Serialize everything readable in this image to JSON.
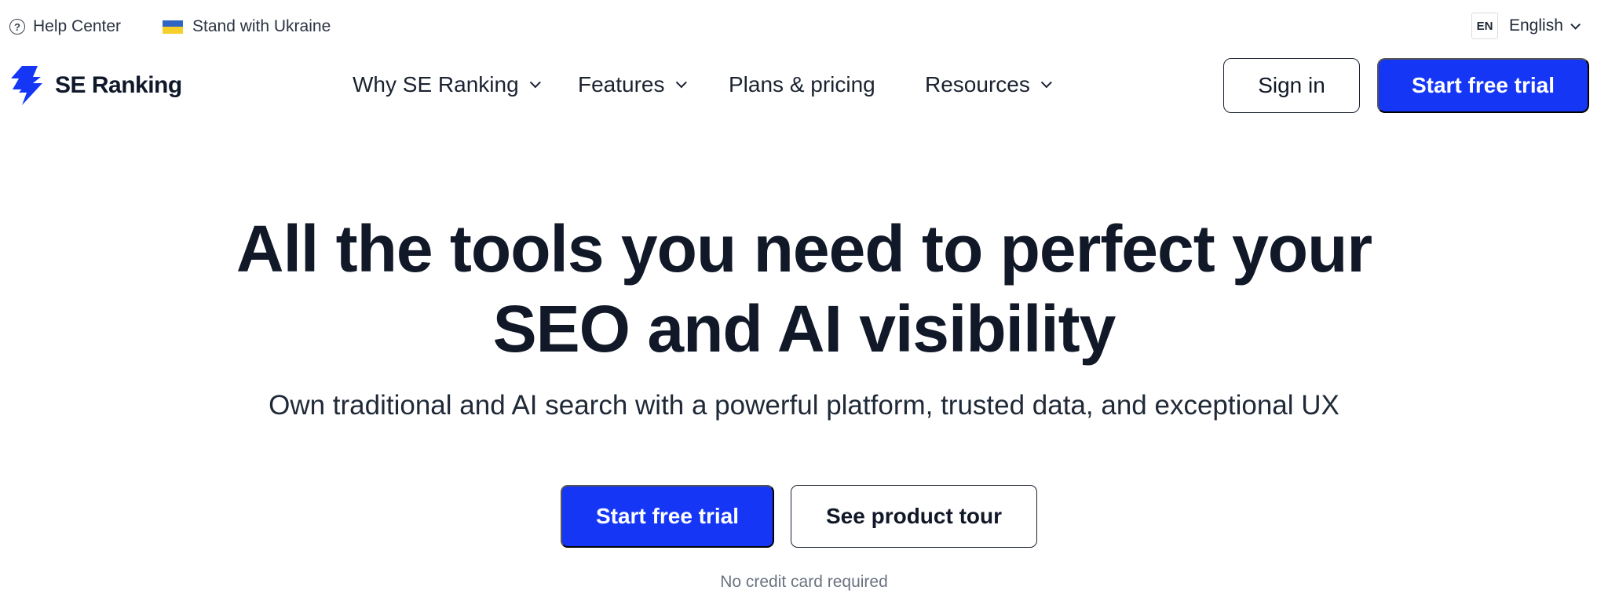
{
  "topbar": {
    "help_label": "Help Center",
    "help_icon": "question-circle-icon",
    "ukraine_label": "Stand with Ukraine",
    "ukraine_flag_colors": [
      "#2f63c4",
      "#f7cf2a"
    ],
    "lang_code": "EN",
    "lang_label": "English"
  },
  "nav": {
    "logo_text": "SE Ranking",
    "items": [
      {
        "label": "Why SE Ranking",
        "has_dropdown": true
      },
      {
        "label": "Features",
        "has_dropdown": true
      },
      {
        "label": "Plans & pricing",
        "has_dropdown": false
      },
      {
        "label": "Resources",
        "has_dropdown": true
      }
    ],
    "signin_label": "Sign in",
    "trial_label": "Start free trial"
  },
  "hero": {
    "title_line1": "All the tools you need to perfect your",
    "title_line2": "SEO and AI visibility",
    "subtitle": "Own traditional and AI search with a powerful platform, trusted data, and exceptional UX",
    "primary_cta": "Start free trial",
    "secondary_cta": "See product tour",
    "note": "No credit card required"
  },
  "colors": {
    "accent": "#1537f5",
    "text": "#111827"
  }
}
